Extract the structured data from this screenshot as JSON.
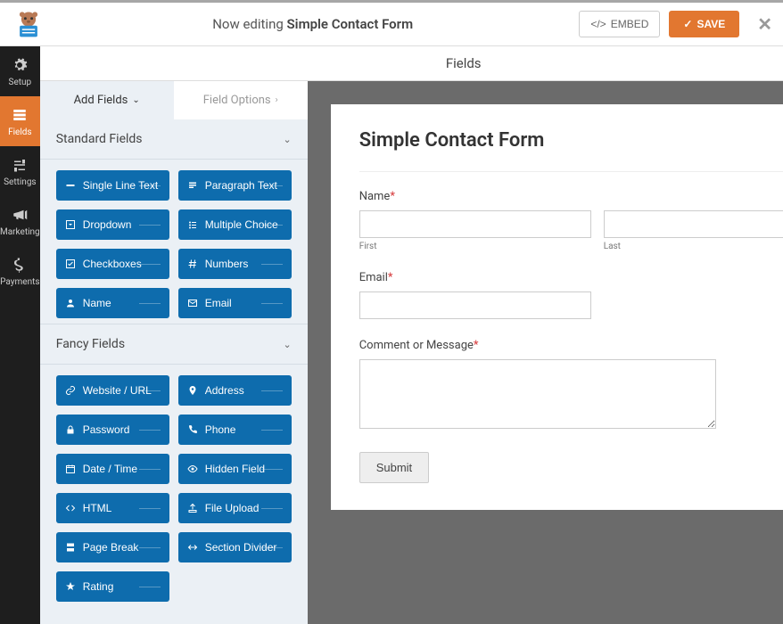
{
  "header": {
    "editing_prefix": "Now editing",
    "form_name": "Simple Contact Form",
    "embed_label": "EMBED",
    "save_label": "SAVE"
  },
  "section_title": "Fields",
  "rail": [
    {
      "label": "Setup"
    },
    {
      "label": "Fields"
    },
    {
      "label": "Settings"
    },
    {
      "label": "Marketing"
    },
    {
      "label": "Payments"
    }
  ],
  "tabs": {
    "add_fields": "Add Fields",
    "field_options": "Field Options"
  },
  "groups": {
    "standard": {
      "title": "Standard Fields",
      "items": [
        "Single Line Text",
        "Paragraph Text",
        "Dropdown",
        "Multiple Choice",
        "Checkboxes",
        "Numbers",
        "Name",
        "Email"
      ]
    },
    "fancy": {
      "title": "Fancy Fields",
      "items": [
        "Website / URL",
        "Address",
        "Password",
        "Phone",
        "Date / Time",
        "Hidden Field",
        "HTML",
        "File Upload",
        "Page Break",
        "Section Divider",
        "Rating"
      ]
    }
  },
  "form": {
    "title": "Simple Contact Form",
    "name_label": "Name",
    "first_label": "First",
    "last_label": "Last",
    "email_label": "Email",
    "comment_label": "Comment or Message",
    "submit_label": "Submit"
  }
}
